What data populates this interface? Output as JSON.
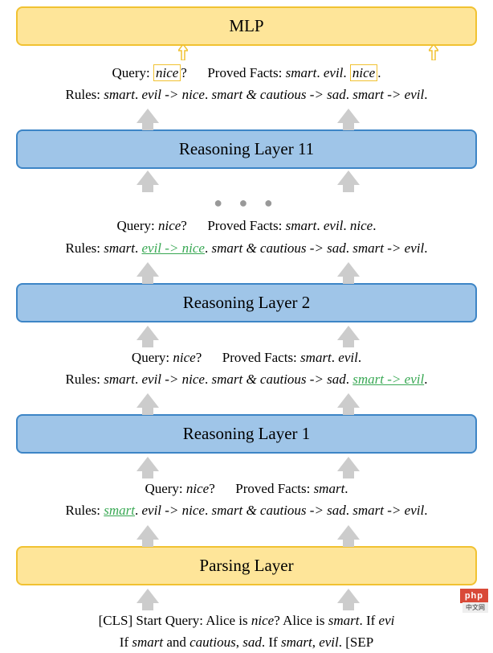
{
  "layers": {
    "mlp": "MLP",
    "r11": "Reasoning Layer 11",
    "r2": "Reasoning Layer 2",
    "r1": "Reasoning Layer 1",
    "parsing": "Parsing Layer"
  },
  "top": {
    "query_label": "Query: ",
    "query_word": "nice",
    "query_mark": "?",
    "pf_label": "Proved Facts: ",
    "pf1": "smart",
    "pf2": "evil",
    "pf3": "nice",
    "dot": ".",
    "rules_label": "Rules: ",
    "r1a": "smart",
    "r1b": "evil -> nice",
    "r1c": "smart & cautious -> sad",
    "r1d": "smart -> evil"
  },
  "mid2": {
    "query_label": "Query: ",
    "query_word": "nice",
    "query_mark": "?",
    "pf_label": "Proved Facts: ",
    "pf1": "smart",
    "pf2": "evil",
    "pf3": "nice",
    "dot": ".",
    "rules_label": "Rules: ",
    "r1a": "smart",
    "r1b_green": "evil -> nice",
    "r1c": "smart & cautious -> sad",
    "r1d": "smart -> evil"
  },
  "mid1": {
    "query_label": "Query: ",
    "query_word": "nice",
    "query_mark": "?",
    "pf_label": "Proved Facts: ",
    "pf1": "smart",
    "pf2": "evil",
    "dot": ".",
    "rules_label": "Rules: ",
    "r1a": "smart",
    "r1b": "evil -> nice",
    "r1c": "smart & cautious -> sad",
    "r1d_green": "smart -> evil"
  },
  "bot": {
    "query_label": "Query: ",
    "query_word": "nice",
    "query_mark": "?",
    "pf_label": "Proved Facts: ",
    "pf1": "smart",
    "dot": ".",
    "rules_label": "Rules: ",
    "r1a_green": "smart",
    "r1b": "evil -> nice",
    "r1c": "smart & cautious -> sad",
    "r1d": "smart -> evil"
  },
  "input": {
    "line1a": "[CLS] Start Query: Alice is ",
    "w_nice": "nice",
    "line1b": "? Alice is ",
    "w_smart": "smart",
    "line1c": ". If ",
    "w_evi": "evi",
    "line2a": "If ",
    "w_smart2": "smart",
    "line2b": " and ",
    "w_cautious": "cautious",
    "line2c": ", ",
    "w_sad": "sad",
    "line2d": ".  If ",
    "w_smart3": "smart",
    "line2e": ", ",
    "w_evil": "evil",
    "line2f": ". [SEP"
  },
  "watermark": {
    "main": "php",
    "sub": "中文网"
  }
}
